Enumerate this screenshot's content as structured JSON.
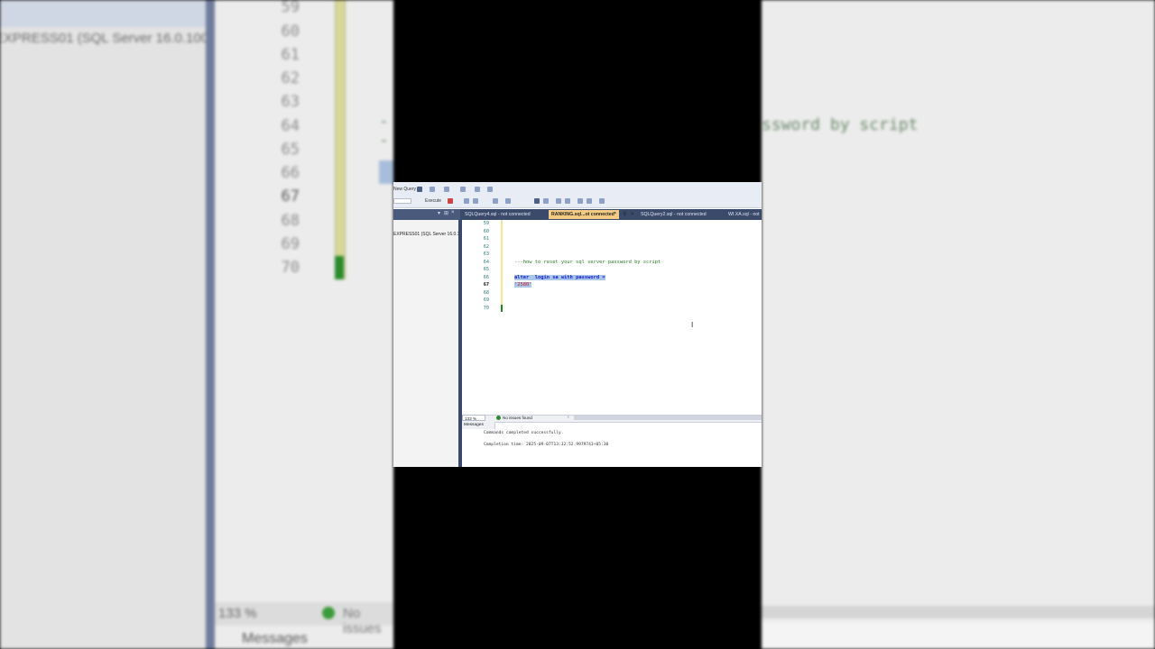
{
  "window": {
    "toolbar": {
      "new_query_label": "New Query",
      "execute_label": "Execute"
    },
    "tabs": [
      {
        "label": "SQLQuery4.sql - not connected",
        "active": false
      },
      {
        "label": "RANKING.sql...ot connected*",
        "active": true
      },
      {
        "label": "SQLQuery2.sql - not connected",
        "active": false
      },
      {
        "label": "WI.XA.sql - not",
        "active": false
      }
    ],
    "object_explorer": {
      "server_label": "EXPRESS01 (SQL Server 16.0.100"
    },
    "editor": {
      "line_numbers": [
        "59",
        "60",
        "61",
        "62",
        "63",
        "64",
        "65",
        "66",
        "67",
        "68",
        "69",
        "70"
      ],
      "current_line": "67",
      "comment_text": "---how to reset your sql server password by script",
      "selected_line1": "alter  login sa with password =",
      "selected_line2": "'2580'"
    },
    "status": {
      "zoom": "133 %",
      "issues": "No issues found"
    },
    "results": {
      "tab_label": "Messages",
      "line1": "Commands completed successfully.",
      "line2": "Completion time: 2025-09-07T13:32:52.9979743+05:30"
    }
  },
  "background": {
    "left_server_label": "EXPRESS01 (SQL Server 16.0.100",
    "left_line_numbers": [
      "59",
      "60",
      "61",
      "62",
      "63",
      "64",
      "65",
      "66",
      "67",
      "68",
      "69",
      "70"
    ],
    "left_zoom": "133 %",
    "left_issues": "No issues",
    "left_messages": "Messages",
    "right_comment": "ssword by script"
  },
  "colors": {
    "accent_tab": "#f5cc84",
    "selection": "#a9c7ec",
    "comment": "#2a7a2a",
    "string": "#c41a1a",
    "keyword": "#1b1bd0"
  }
}
